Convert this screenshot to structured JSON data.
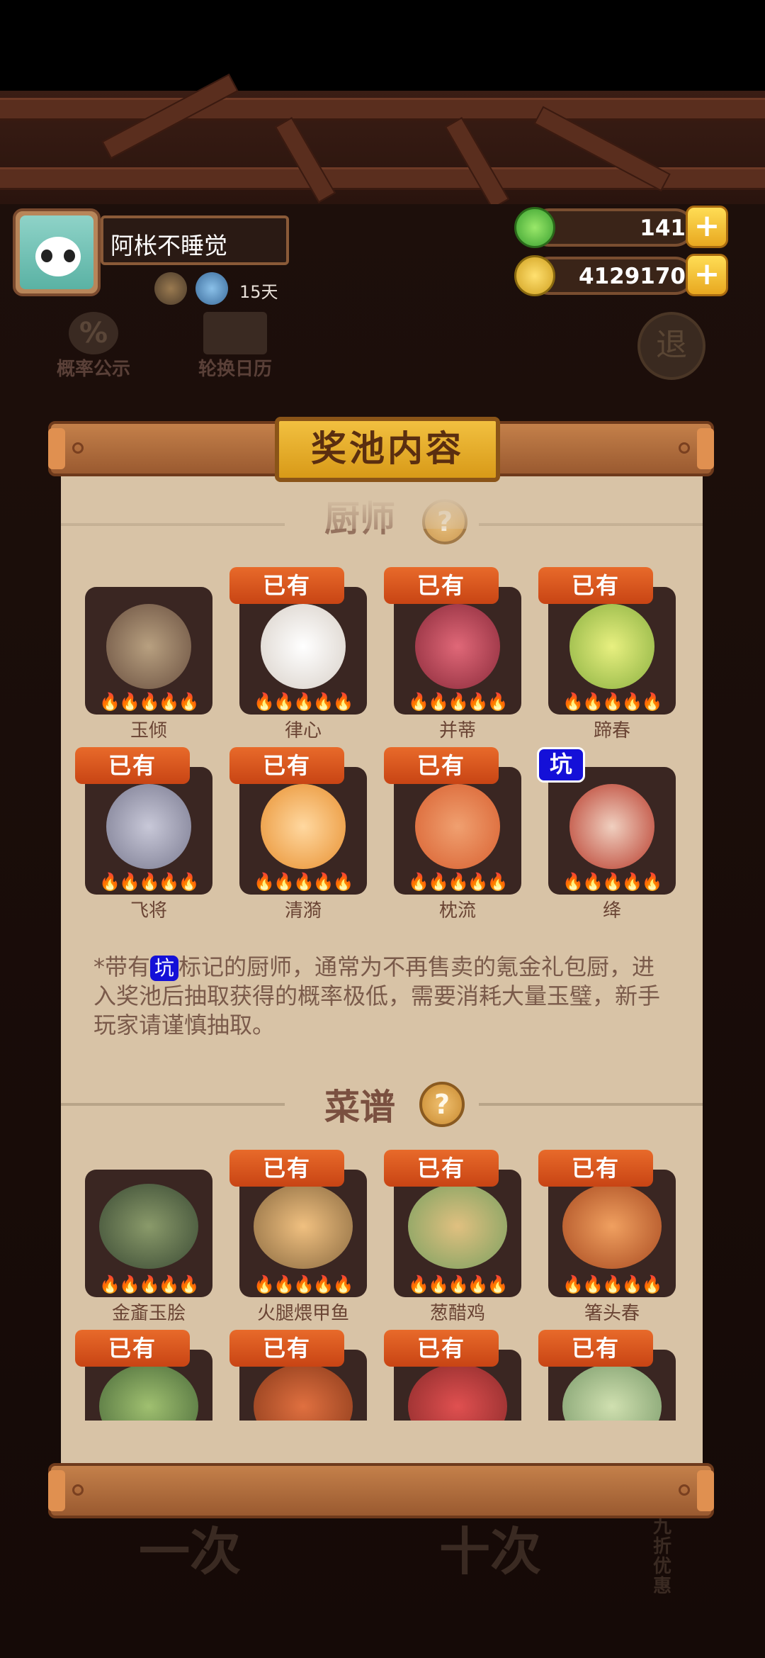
{
  "player": {
    "name": "阿枨不睡觉",
    "days": "15天"
  },
  "currency": {
    "jade": "141",
    "coins": "4129170"
  },
  "toolbar": {
    "probability_label": "概率公示",
    "calendar_label": "轮换日历",
    "exit_label": "退"
  },
  "panel": {
    "title": "奖池内容"
  },
  "sections": {
    "chef": "厨师",
    "recipe": "菜谱"
  },
  "help_glyph": "?",
  "badges": {
    "owned": "已有",
    "keng": "坑"
  },
  "flames": "🔥🔥🔥🔥🔥",
  "chefs": [
    {
      "name": "玉倾",
      "owned": false
    },
    {
      "name": "律心",
      "owned": true
    },
    {
      "name": "并蒂",
      "owned": true
    },
    {
      "name": "蹄春",
      "owned": true
    },
    {
      "name": "飞将",
      "owned": true
    },
    {
      "name": "清漪",
      "owned": true
    },
    {
      "name": "枕流",
      "owned": true
    },
    {
      "name": "绛",
      "owned": false,
      "keng": true
    }
  ],
  "note": {
    "prefix": "*带有",
    "badge": "坑",
    "suffix": "标记的厨师，通常为不再售卖的氪金礼包厨，进入奖池后抽取获得的概率极低，需要消耗大量玉璧，新手玩家请谨慎抽取。"
  },
  "recipes": [
    {
      "name": "金齑玉脍",
      "owned": false
    },
    {
      "name": "火腿煨甲鱼",
      "owned": true
    },
    {
      "name": "葱醋鸡",
      "owned": true
    },
    {
      "name": "箸头春",
      "owned": true
    },
    {
      "name": "",
      "owned": true
    },
    {
      "name": "",
      "owned": true
    },
    {
      "name": "",
      "owned": true
    },
    {
      "name": "",
      "owned": true
    }
  ],
  "background": {
    "btn1": "一次",
    "btn2": "十次",
    "discount": "九折优惠"
  }
}
